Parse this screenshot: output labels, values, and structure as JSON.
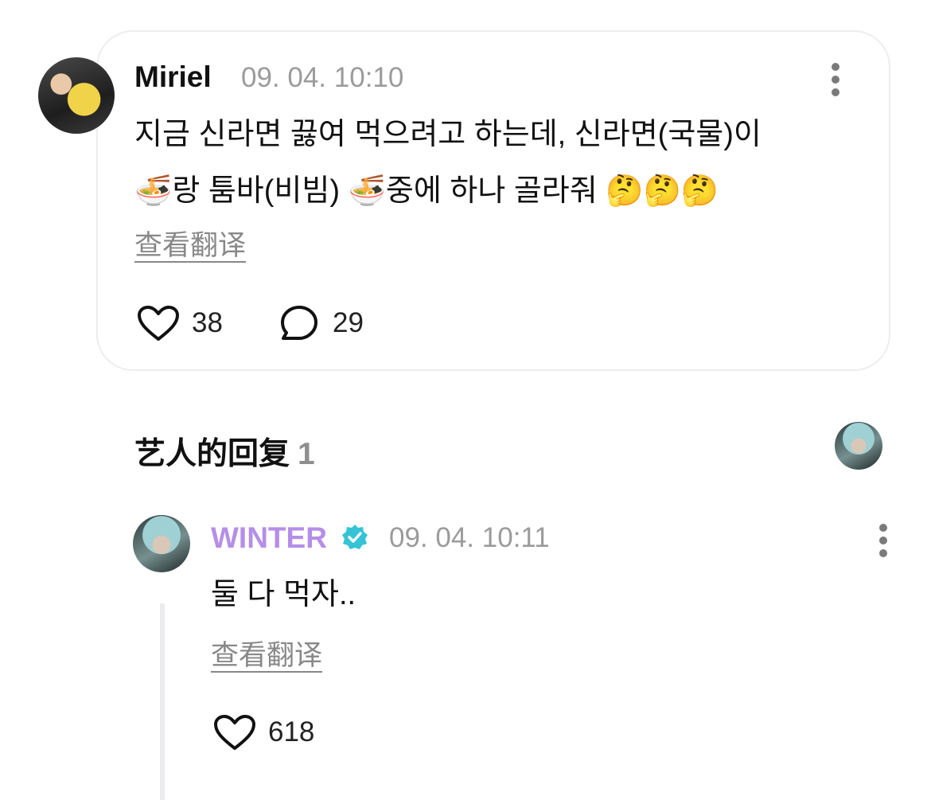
{
  "comment": {
    "username": "Miriel",
    "timestamp": "09. 04. 10:10",
    "line1": "지금 신라면 끓여 먹으려고 하는데, 신라면(국물)이",
    "line2_emoji_a": "🍜",
    "line2_text_a": "랑 툼바(비빔) ",
    "line2_emoji_b": "🍜",
    "line2_text_b": "중에 하나 골라줘 ",
    "line2_emoji_c": "🤔🤔🤔",
    "translate_label": "查看翻译",
    "likes": "38",
    "replies": "29"
  },
  "artist_section": {
    "title": "艺人的回复",
    "count": "1"
  },
  "reply": {
    "username": "WINTER",
    "timestamp": "09. 04. 10:11",
    "text": "둘 다 먹자..",
    "translate_label": "查看翻译",
    "likes": "618"
  },
  "colors": {
    "artist_name": "#b58ee8",
    "verified_badge": "#35c3d6",
    "timestamp": "#9b9b9b"
  },
  "icons": [
    "more-vertical-icon",
    "heart-icon",
    "comment-bubble-icon",
    "verified-badge-icon"
  ]
}
